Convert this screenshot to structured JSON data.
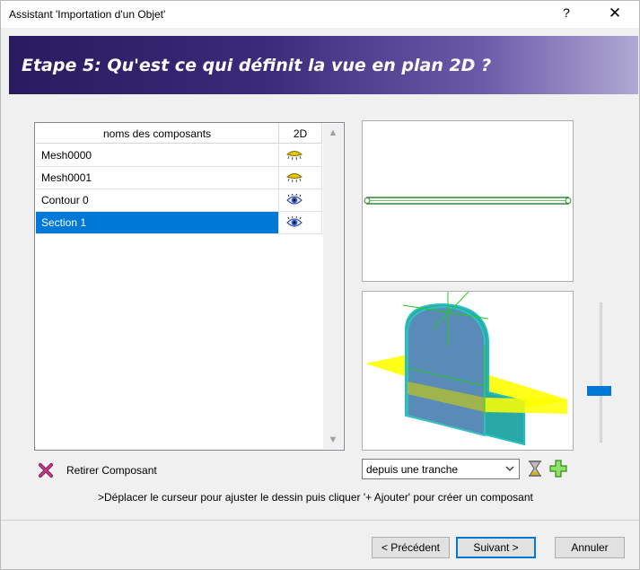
{
  "window": {
    "title": "Assistant 'Importation d'un Objet'",
    "help_label": "?",
    "close_label": "✕"
  },
  "banner": {
    "heading": "Etape 5: Qu'est ce qui définit la vue en plan 2D ?"
  },
  "components": {
    "columns": [
      "noms des composants",
      "2D"
    ],
    "rows": [
      {
        "name": "Mesh0000",
        "icon": "closed-eye-icon",
        "selected": false
      },
      {
        "name": "Mesh0001",
        "icon": "closed-eye-icon",
        "selected": false
      },
      {
        "name": "Contour 0",
        "icon": "open-eye-icon",
        "selected": false
      },
      {
        "name": "Section 1",
        "icon": "open-eye-icon",
        "selected": true
      }
    ]
  },
  "actions": {
    "remove_label": "Retirer Composant",
    "source_select_value": "depuis une tranche",
    "hint": ">Déplacer le curseur pour ajuster le dessin puis cliquer '+ Ajouter' pour créer un composant"
  },
  "footer": {
    "previous_label": "< Précédent",
    "next_label": "Suivant >",
    "cancel_label": "Annuler"
  },
  "colors": {
    "selection": "#0078d7",
    "banner_dark": "#2a1a5e",
    "section_plane": "#f0f000",
    "solid": "#5a8ab8"
  }
}
